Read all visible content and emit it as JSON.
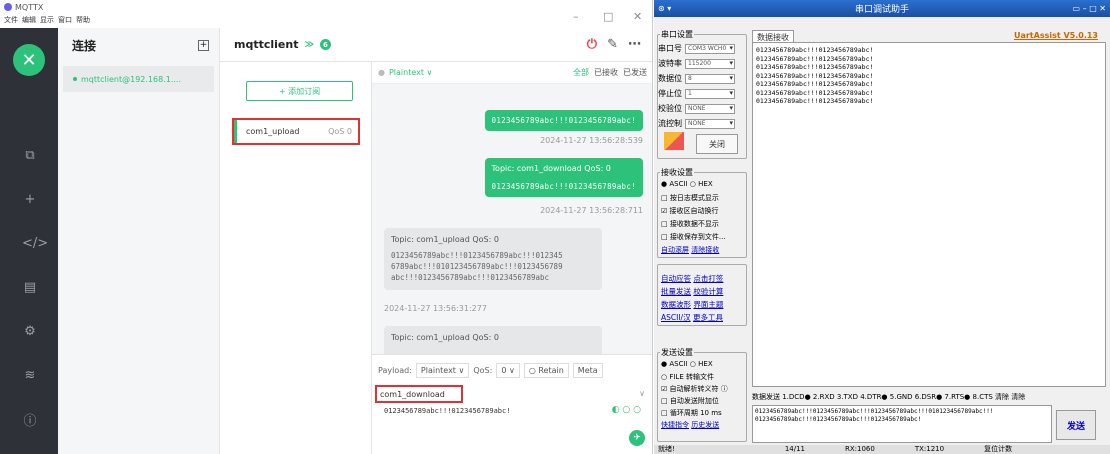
{
  "mqtt": {
    "window_title": "MQTTX",
    "menu": [
      "文件",
      "编辑",
      "显示",
      "窗口",
      "帮助"
    ],
    "sidebar_logo": "✕",
    "connections_title": "连接",
    "connection_item": "mqttclient@192.168.1....",
    "client_name": "mqttclient",
    "client_badge": "6",
    "add_subscription": "+ 添加订阅",
    "subscription": {
      "topic": "com1_upload",
      "qos": "QoS 0"
    },
    "payload_format": "Plaintext",
    "filters": [
      "全部",
      "已接收",
      "已发送"
    ],
    "messages": [
      {
        "type": "out",
        "topic": "",
        "text": "0123456789abc!!!0123456789abc!",
        "time": "2024-11-27 13:56:28:539"
      },
      {
        "type": "out",
        "topic": "Topic: com1_download   QoS: 0",
        "text": "0123456789abc!!!0123456789abc!",
        "time": "2024-11-27 13:56:28:711"
      },
      {
        "type": "in",
        "topic": "Topic: com1_upload   QoS: 0",
        "lines": [
          "0123456789abc!!!0123456789abc!!!012345",
          "6789abc!!!010123456789abc!!!0123456789",
          "abc!!!0123456789abc!!!0123456789abc"
        ],
        "time": "2024-11-27 13:56:31:277"
      },
      {
        "type": "in",
        "topic": "Topic: com1_upload   QoS: 0"
      }
    ],
    "composer": {
      "payload_label": "Payload:",
      "payload_type": "Plaintext",
      "qos_label": "QoS:",
      "qos": "0",
      "retain": "Retain",
      "meta": "Meta",
      "topic": "com1_download",
      "payload": "0123456789abc!!!0123456789abc!"
    }
  },
  "uart": {
    "title": "串口调试助手",
    "serial_group": "串口设置",
    "rows": [
      {
        "label": "串口号",
        "value": "COM3 WCH0"
      },
      {
        "label": "波特率",
        "value": "115200"
      },
      {
        "label": "数据位",
        "value": "8"
      },
      {
        "label": "停止位",
        "value": "1"
      },
      {
        "label": "校验位",
        "value": "NONE"
      },
      {
        "label": "流控制",
        "value": "NONE"
      }
    ],
    "close_button": "关闭",
    "recv_group": "接收设置",
    "recv_opts": [
      "● ASCII  ○ HEX",
      "□ 按日志模式显示",
      "☑ 接收区自动换行",
      "□ 接收数据不显示",
      "□ 接收保存到文件..."
    ],
    "recv_links": [
      "自动滚屏",
      "清除接收"
    ],
    "tools": [
      "自动应答",
      "点击打签",
      "批量发送",
      "校验计算",
      "数据波形",
      "界面主题",
      "ASCII/汉",
      "更多工具"
    ],
    "send_group": "发送设置",
    "send_opts": [
      "● ASCII  ○ HEX",
      "○ FILE 转输文件",
      "☑ 自动解析转义符 ⓘ",
      "□ 自动发送附加位",
      "□ 循环周期  10  ms"
    ],
    "send_links": [
      "快捷指令",
      "历史发送"
    ],
    "tab": "数据接收",
    "version": "UartAssist V5.0.13",
    "received": [
      "0123456789abc!!!0123456789abc!",
      "0123456789abc!!!0123456789abc!",
      "0123456789abc!!!0123456789abc!",
      "0123456789abc!!!0123456789abc!",
      "0123456789abc!!!0123456789abc!",
      "0123456789abc!!!0123456789abc!",
      "0123456789abc!!!0123456789abc!"
    ],
    "sendbar": "数据发送  1.DCD● 2.RXD 3.TXD 4.DTR● 5.GND 6.DSR● 7.RTS● 8.CTS  清除  清除",
    "send_text": [
      "0123456789abc!!!0123456789abc!!!0123456789abc!!!010123456789abc!!!",
      "0123456789abc!!!0123456789abc!!!0123456789abc!"
    ],
    "send_button": "发送",
    "status": [
      "就绪!",
      "14/11",
      "RX:1060",
      "TX:1210",
      "复位计数"
    ]
  }
}
